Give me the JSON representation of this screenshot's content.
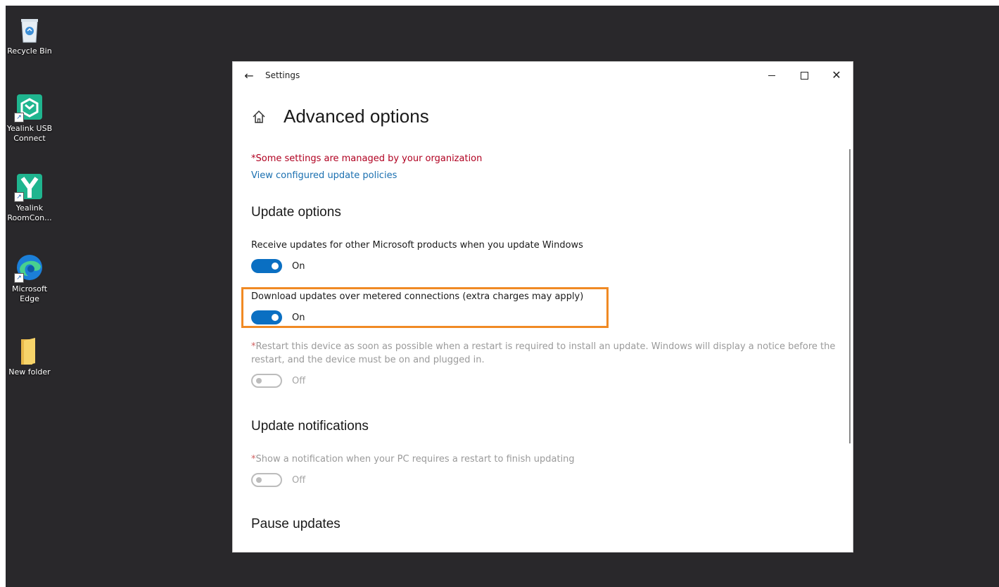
{
  "desktop": {
    "icons": [
      {
        "label": "Recycle Bin",
        "icon": "recycle-bin-icon"
      },
      {
        "label": "Yealink USB\nConnect",
        "icon": "yealink-usb-connect-icon"
      },
      {
        "label": "Yealink\nRoomCon...",
        "icon": "yealink-roomconnect-icon"
      },
      {
        "label": "Microsoft\nEdge",
        "icon": "edge-icon"
      },
      {
        "label": "New folder",
        "icon": "folder-icon"
      }
    ]
  },
  "window": {
    "app_title": "Settings",
    "page_title": "Advanced options",
    "org_note": "*Some settings are managed by your organization",
    "policy_link": "View configured update policies",
    "update_options": {
      "title": "Update options",
      "settings": [
        {
          "label": "Receive updates for other Microsoft products when you update Windows",
          "state": "On",
          "enabled": true
        },
        {
          "label": "Download updates over metered connections (extra charges may apply)",
          "state": "On",
          "enabled": true
        },
        {
          "req": "*",
          "label": "Restart this device as soon as possible when a restart is required to install an update. Windows will display a notice before the restart, and the device must be on and plugged in.",
          "state": "Off",
          "enabled": false
        }
      ]
    },
    "update_notifications": {
      "title": "Update notifications",
      "settings": [
        {
          "req": "*",
          "label": "Show a notification when your PC requires a restart to finish updating",
          "state": "Off",
          "enabled": false
        }
      ]
    },
    "pause_updates": {
      "title": "Pause updates"
    }
  },
  "colors": {
    "accent": "#0a6fc2",
    "highlight": "#f08a24",
    "warning": "#b00020",
    "link": "#1a6fb0"
  }
}
